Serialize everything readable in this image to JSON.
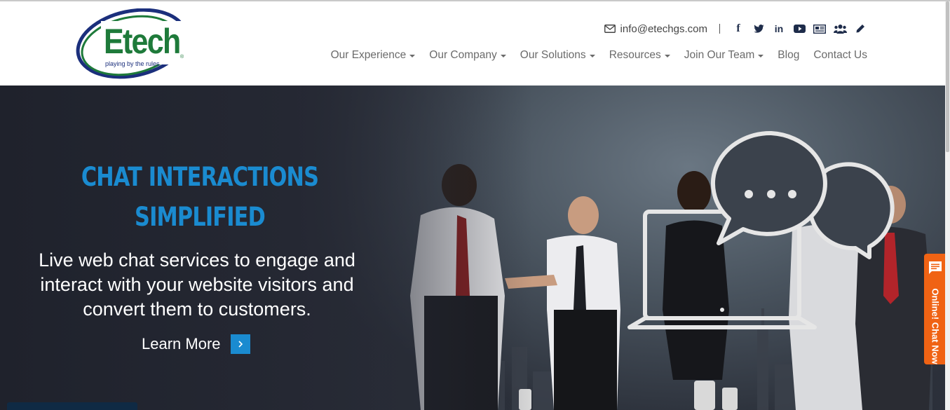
{
  "header": {
    "logo": {
      "word": "Etech",
      "tagline": "playing by the rules",
      "mark": "®"
    },
    "email": "info@etechgs.com",
    "social_icons": [
      "facebook-icon",
      "twitter-icon",
      "linkedin-icon",
      "youtube-icon",
      "newsletter-icon",
      "community-icon",
      "blog-pencil-icon"
    ],
    "social": {
      "facebook": "f",
      "linkedin": "in"
    },
    "nav": [
      {
        "label": "Our Experience",
        "dropdown": true
      },
      {
        "label": "Our Company",
        "dropdown": true
      },
      {
        "label": "Our Solutions",
        "dropdown": true
      },
      {
        "label": "Resources",
        "dropdown": true
      },
      {
        "label": "Join Our Team",
        "dropdown": true
      },
      {
        "label": "Blog",
        "dropdown": false
      },
      {
        "label": "Contact Us",
        "dropdown": false
      }
    ]
  },
  "hero": {
    "headline_line1": "CHAT INTERACTIONS",
    "headline_line2": "SIMPLIFIED",
    "subtext": "Live web chat services to engage and interact with your website visitors and convert them to customers.",
    "cta_label": "Learn More",
    "cta_icon": "chevron-right-icon"
  },
  "chat_widget": {
    "label": "Online! Chat Now",
    "icon": "chat-bubble-icon"
  },
  "colors": {
    "brand_green": "#1e7a3a",
    "brand_navy": "#1b2f7c",
    "accent_blue": "#1a8bd0",
    "chat_orange": "#f06314",
    "nav_text": "#6b6b6b"
  }
}
